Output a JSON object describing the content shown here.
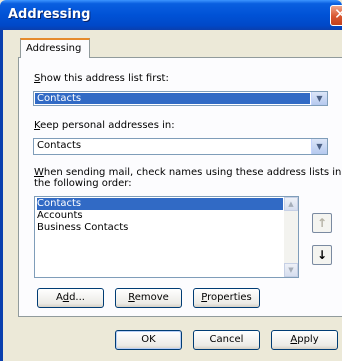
{
  "window": {
    "title": "Addressing"
  },
  "tab": {
    "label": "Addressing"
  },
  "show_first": {
    "label_hotkey": "S",
    "label_rest": "how this address list first:",
    "value": "Contacts"
  },
  "keep_personal": {
    "label_hotkey": "K",
    "label_rest": "eep personal addresses in:",
    "value": "Contacts"
  },
  "check_names": {
    "label_hotkey": "W",
    "label_line1_rest": "hen sending mail, check names using these address lists in",
    "label_line2": "the following order:",
    "items": [
      "Contacts",
      "Accounts",
      "Business Contacts"
    ],
    "selected_index": 0
  },
  "side_buttons": {
    "up_glyph": "↑",
    "down_glyph": "↓"
  },
  "list_buttons": {
    "add_pre": "A",
    "add_hotkey": "d",
    "add_post": "d...",
    "remove_pre": "",
    "remove_hotkey": "R",
    "remove_post": "emove",
    "properties_pre": "",
    "properties_hotkey": "P",
    "properties_post": "roperties"
  },
  "dialog_buttons": {
    "ok": "OK",
    "cancel": "Cancel",
    "apply_hotkey": "A",
    "apply_rest": "pply"
  },
  "colors": {
    "titlebar": "#0052d6",
    "selection": "#316ac5",
    "tab_accent": "#e68b2c",
    "dialog_bg": "#ece9d8"
  },
  "icons": {
    "combo_arrow": "chevron-down-icon",
    "close": "close-icon"
  }
}
